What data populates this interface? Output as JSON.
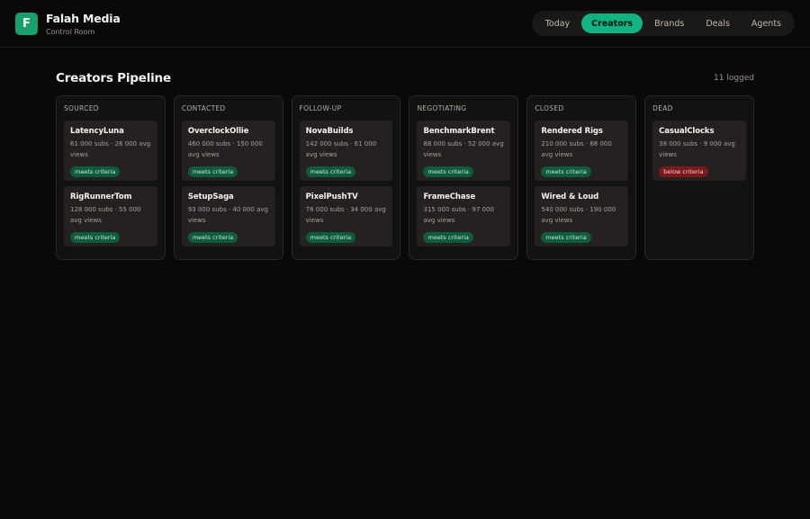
{
  "brand": {
    "logo_letter": "F",
    "name": "Falah Media",
    "subtitle": "Control Room"
  },
  "nav": [
    {
      "label": "Today",
      "active": false
    },
    {
      "label": "Creators",
      "active": true
    },
    {
      "label": "Brands",
      "active": false
    },
    {
      "label": "Deals",
      "active": false
    },
    {
      "label": "Agents",
      "active": false
    }
  ],
  "page": {
    "title": "Creators Pipeline",
    "count": "11 logged"
  },
  "columns": [
    {
      "title": "SOURCED",
      "cards": [
        {
          "name": "LatencyLuna",
          "stats": "61 000 subs · 26 000 avg views",
          "badge": "meets criteria",
          "status": "ok"
        },
        {
          "name": "RigRunnerTom",
          "stats": "128 000 subs · 55 000 avg views",
          "badge": "meets criteria",
          "status": "ok"
        }
      ]
    },
    {
      "title": "CONTACTED",
      "cards": [
        {
          "name": "OverclockOllie",
          "stats": "460 000 subs · 150 000 avg views",
          "badge": "meets criteria",
          "status": "ok"
        },
        {
          "name": "SetupSaga",
          "stats": "93 000 subs · 40 000 avg views",
          "badge": "meets criteria",
          "status": "ok"
        }
      ]
    },
    {
      "title": "FOLLOW-UP",
      "cards": [
        {
          "name": "NovaBuilds",
          "stats": "142 000 subs · 61 000 avg views",
          "badge": "meets criteria",
          "status": "ok"
        },
        {
          "name": "PixelPushTV",
          "stats": "76 000 subs · 34 000 avg views",
          "badge": "meets criteria",
          "status": "ok"
        }
      ]
    },
    {
      "title": "NEGOTIATING",
      "cards": [
        {
          "name": "BenchmarkBrent",
          "stats": "88 000 subs · 52 000 avg views",
          "badge": "meets criteria",
          "status": "ok"
        },
        {
          "name": "FrameChase",
          "stats": "315 000 subs · 97 000 avg views",
          "badge": "meets criteria",
          "status": "ok"
        }
      ]
    },
    {
      "title": "CLOSED",
      "cards": [
        {
          "name": "Rendered Rigs",
          "stats": "210 000 subs · 68 000 avg views",
          "badge": "meets criteria",
          "status": "ok"
        },
        {
          "name": "Wired & Loud",
          "stats": "540 000 subs · 190 000 avg views",
          "badge": "meets criteria",
          "status": "ok"
        }
      ]
    },
    {
      "title": "DEAD",
      "cards": [
        {
          "name": "CasualClocks",
          "stats": "38 000 subs · 9 000 avg views",
          "badge": "below criteria",
          "status": "bad"
        }
      ]
    }
  ],
  "colors": {
    "accent": "#12b383",
    "logo": "#1a9e6b",
    "ok_badge": "#0f5c3d",
    "bad_badge": "#7a1a1a"
  }
}
